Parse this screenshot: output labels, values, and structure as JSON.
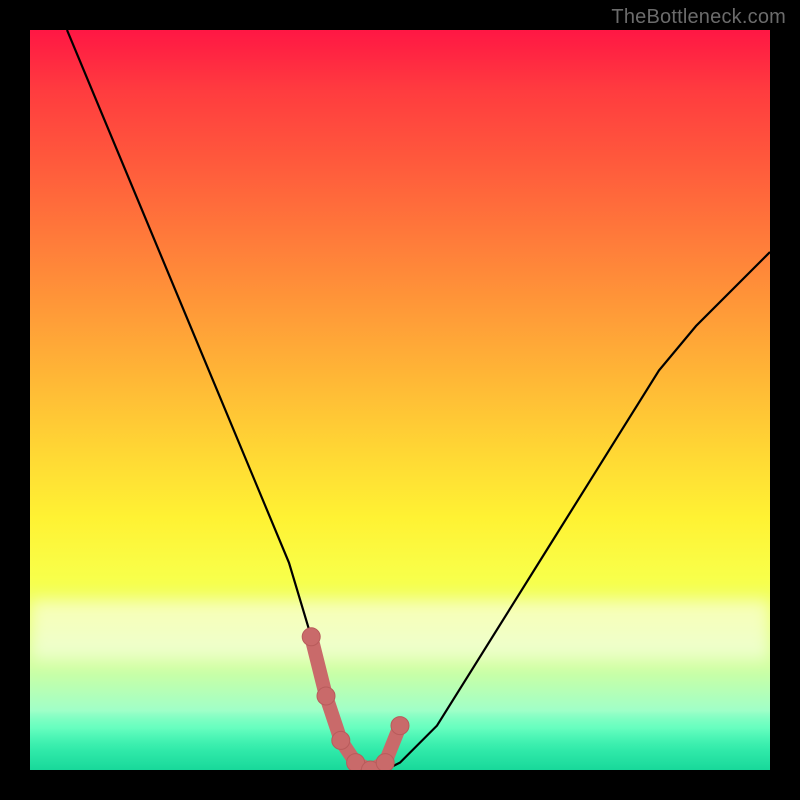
{
  "attribution": "TheBottleneck.com",
  "colors": {
    "curve_stroke": "#000000",
    "marker_fill": "#c96a6a",
    "marker_stroke": "#b85b5b"
  },
  "chart_data": {
    "type": "line",
    "title": "",
    "xlabel": "",
    "ylabel": "",
    "xlim": [
      0,
      100
    ],
    "ylim": [
      0,
      100
    ],
    "grid": false,
    "legend": false,
    "series": [
      {
        "name": "bottleneck-curve",
        "x": [
          5,
          10,
          15,
          20,
          25,
          30,
          35,
          38,
          40,
          42,
          44,
          46,
          48,
          50,
          55,
          60,
          65,
          70,
          75,
          80,
          85,
          90,
          95,
          100
        ],
        "values": [
          100,
          88,
          76,
          64,
          52,
          40,
          28,
          18,
          10,
          4,
          1,
          0,
          0,
          1,
          6,
          14,
          22,
          30,
          38,
          46,
          54,
          60,
          65,
          70
        ]
      }
    ],
    "markers": {
      "name": "trough-markers",
      "x": [
        38,
        40,
        42,
        44,
        46,
        48,
        50
      ],
      "values": [
        18,
        10,
        4,
        1,
        0,
        1,
        6
      ]
    }
  }
}
